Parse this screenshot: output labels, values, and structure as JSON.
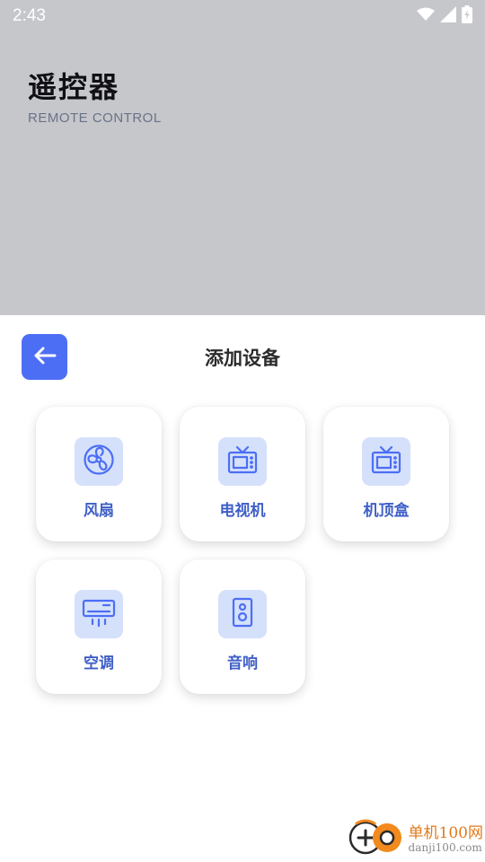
{
  "status_bar": {
    "time": "2:43",
    "icons": [
      "wifi-icon",
      "signal-icon",
      "battery-icon"
    ]
  },
  "header": {
    "title": "遥控器",
    "subtitle": "REMOTE CONTROL"
  },
  "sheet": {
    "back_icon": "arrow-left-icon",
    "title": "添加设备"
  },
  "devices": [
    {
      "label": "风扇",
      "icon": "fan-icon"
    },
    {
      "label": "电视机",
      "icon": "tv-icon"
    },
    {
      "label": "机顶盒",
      "icon": "tv-box-icon"
    },
    {
      "label": "空调",
      "icon": "air-conditioner-icon"
    },
    {
      "label": "音响",
      "icon": "speaker-icon"
    }
  ],
  "watermark": {
    "main": "单机100网",
    "sub": "danji100.com"
  },
  "colors": {
    "header_bg": "#c6c7cb",
    "accent": "#4c6ef5",
    "icon_bg": "#d5e1fb",
    "label": "#3f5fc7"
  }
}
